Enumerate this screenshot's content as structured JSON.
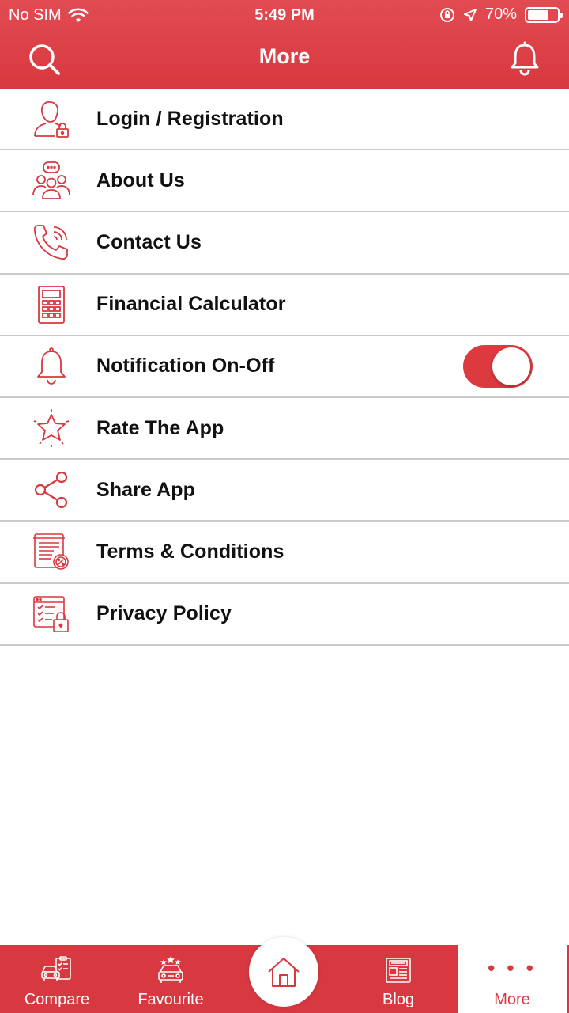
{
  "status_bar": {
    "carrier": "No SIM",
    "time": "5:49 PM",
    "battery": "70%"
  },
  "nav": {
    "title": "More",
    "left_icon": "search-icon",
    "right_icon": "bell-icon"
  },
  "menu": {
    "items": [
      {
        "label": "Login / Registration",
        "icon": "user-lock-icon"
      },
      {
        "label": "About Us",
        "icon": "team-icon"
      },
      {
        "label": "Contact Us",
        "icon": "phone-icon"
      },
      {
        "label": "Financial Calculator",
        "icon": "calculator-icon"
      },
      {
        "label": "Notification On-Off",
        "icon": "bell-icon",
        "toggle_on": true
      },
      {
        "label": "Rate The App",
        "icon": "star-icon"
      },
      {
        "label": "Share App",
        "icon": "share-icon"
      },
      {
        "label": "Terms & Conditions",
        "icon": "document-icon"
      },
      {
        "label": "Privacy Policy",
        "icon": "privacy-lock-icon"
      }
    ]
  },
  "tabs": {
    "compare": "Compare",
    "favourite": "Favourite",
    "blog": "Blog",
    "more": "More",
    "more_glyph": "• • •"
  },
  "colors": {
    "accent": "#d8383f",
    "divider": "#c9c9c9",
    "text": "#111111"
  }
}
